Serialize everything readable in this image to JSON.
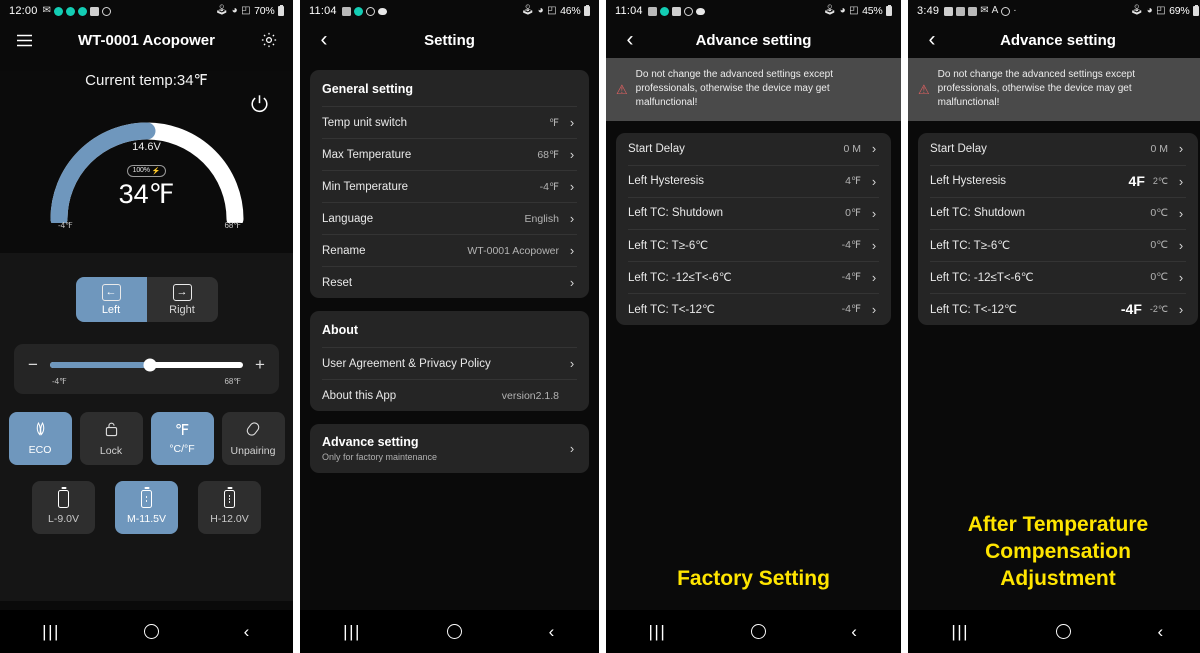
{
  "panel1": {
    "statusbar": {
      "time": "12:00",
      "battery_pct": "70%",
      "left_icons": [
        "mail-icon",
        "dot-icon",
        "dot-icon",
        "dot-icon",
        "device-icon",
        "dnd-icon"
      ],
      "right_icons": [
        "bluetooth-icon",
        "wifi-icon",
        "signal-icon",
        "battery-icon"
      ]
    },
    "appbar": {
      "menu": "menu-icon",
      "title": "WT-0001 Acopower",
      "settings": "gear-icon"
    },
    "current_temp_label": "Current temp:34℉",
    "gauge": {
      "voltage": "14.6V",
      "battery_badge": "100%",
      "battery_badge_icon": "⚡",
      "value": "34℉",
      "min": "-4℉",
      "max": "68℉",
      "fill_pct": 50,
      "fill_color": "#6f97bd",
      "track_color": "#ffffff"
    },
    "power_button": "power-icon",
    "segmented": [
      {
        "label": "Left",
        "icon": "←",
        "active": true
      },
      {
        "label": "Right",
        "icon": "→",
        "active": false
      }
    ],
    "slider": {
      "minus": "−",
      "plus": "+",
      "min_label": "-4℉",
      "max_label": "68℉",
      "fill_pct": 52
    },
    "tiles_row1": [
      {
        "label": "ECO",
        "icon": "❀",
        "active": true
      },
      {
        "label": "Lock",
        "icon": "⚿",
        "active": false
      },
      {
        "label": "°C/°F",
        "icon": "℉",
        "active": true
      },
      {
        "label": "Unpairing",
        "icon": "⚭",
        "active": false
      }
    ],
    "tiles_row2": [
      {
        "label": "L-9.0V",
        "active": false
      },
      {
        "label": "M-11.5V",
        "active": true
      },
      {
        "label": "H-12.0V",
        "active": false
      }
    ],
    "navbar": {
      "recents": "|||",
      "home": "home-icon",
      "back": "‹"
    }
  },
  "panel2": {
    "statusbar": {
      "time": "11:04",
      "battery_pct": "46%"
    },
    "appbar": {
      "back": "‹",
      "title": "Setting"
    },
    "general": {
      "title": "General setting",
      "rows": [
        {
          "label": "Temp unit switch",
          "value": "℉"
        },
        {
          "label": "Max Temperature",
          "value": "68℉"
        },
        {
          "label": "Min Temperature",
          "value": "-4℉"
        },
        {
          "label": "Language",
          "value": "English"
        },
        {
          "label": "Rename",
          "value": "WT-0001 Acopower"
        },
        {
          "label": "Reset",
          "value": ""
        }
      ]
    },
    "about": {
      "title": "About",
      "rows": [
        {
          "label": "User Agreement & Privacy Policy",
          "value": "",
          "chevron": true
        },
        {
          "label": "About this App",
          "value": "version2.1.8",
          "chevron": false
        }
      ]
    },
    "advance": {
      "title": "Advance setting",
      "subtitle": "Only for factory maintenance"
    },
    "navbar": {
      "recents": "|||",
      "home": "home-icon",
      "back": "‹"
    }
  },
  "panel3": {
    "statusbar": {
      "time": "11:04",
      "battery_pct": "45%"
    },
    "appbar": {
      "back": "‹",
      "title": "Advance setting"
    },
    "warning": {
      "icon": "warning-triangle-icon",
      "text": "Do not change the advanced settings except professionals, otherwise the device may get malfunctional!"
    },
    "rows": [
      {
        "label": "Start Delay",
        "value": "0 M"
      },
      {
        "label": "Left Hysteresis",
        "value": "4℉"
      },
      {
        "label": "Left TC: Shutdown",
        "value": "0℉"
      },
      {
        "label": "Left TC: T≥-6℃",
        "value": "-4℉"
      },
      {
        "label": "Left TC: -12≤T<-6℃",
        "value": "-4℉"
      },
      {
        "label": "Left TC: T<-12℃",
        "value": "-4℉"
      }
    ],
    "caption": "Factory Setting",
    "caption_color": "#ffe500",
    "navbar": {
      "recents": "|||",
      "home": "home-icon",
      "back": "‹"
    }
  },
  "panel4": {
    "statusbar": {
      "time": "3:49",
      "battery_pct": "69%"
    },
    "appbar": {
      "back": "‹",
      "title": "Advance setting"
    },
    "warning": {
      "icon": "warning-triangle-icon",
      "text": "Do not change the advanced settings except professionals, otherwise the device may get malfunctional!"
    },
    "rows": [
      {
        "label": "Start Delay",
        "value": "0 M",
        "highlight": ""
      },
      {
        "label": "Left Hysteresis",
        "value": "2℃",
        "highlight": "4F"
      },
      {
        "label": "Left TC: Shutdown",
        "value": "0℃",
        "highlight": ""
      },
      {
        "label": "Left TC: T≥-6℃",
        "value": "0℃",
        "highlight": ""
      },
      {
        "label": "Left TC: -12≤T<-6℃",
        "value": "0℃",
        "highlight": ""
      },
      {
        "label": "Left TC: T<-12℃",
        "value": "-2℃",
        "highlight": "-4F"
      }
    ],
    "caption_line1": "After Temperature",
    "caption_line2": "Compensation",
    "caption_line3": "Adjustment",
    "caption_color": "#ffe500",
    "navbar": {
      "recents": "|||",
      "home": "home-icon",
      "back": "‹"
    }
  }
}
